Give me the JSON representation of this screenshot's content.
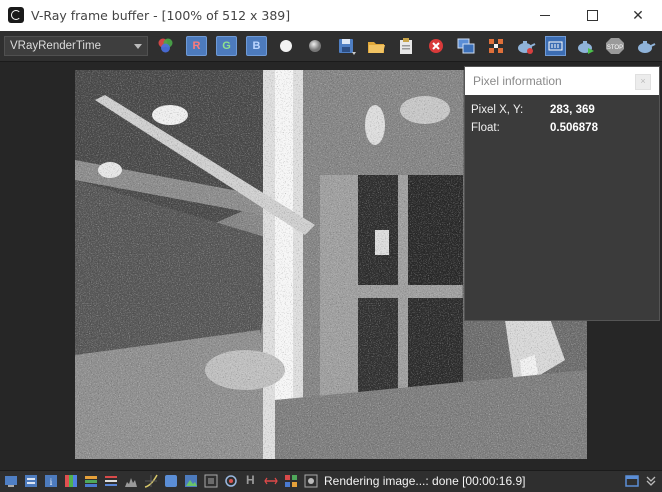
{
  "window": {
    "title": "V-Ray frame buffer - [100% of 512 x 389]",
    "controls": {
      "minimize_icon": "minimize-icon",
      "maximize_icon": "maximize-icon",
      "close_glyph": "✕"
    }
  },
  "toolbar": {
    "channel": "VRayRenderTime",
    "channel_icon": "rgb-circles-icon",
    "r_label": "R",
    "g_label": "G",
    "b_label": "B",
    "icons": [
      "white-dot-icon",
      "gray-dot-icon",
      "save-icon",
      "open-folder-icon",
      "clipboard-icon",
      "clear-icon",
      "duplicate-icon",
      "region-icon",
      "render-teapot-icon",
      "history-icon",
      "interactive-teapot-icon",
      "stop-icon",
      "render-last-icon"
    ]
  },
  "pixel_info": {
    "title": "Pixel information",
    "rows": [
      {
        "label": "Pixel X, Y:",
        "value": "283, 369"
      },
      {
        "label": "Float:",
        "value": "0.506878"
      }
    ]
  },
  "statusbar": {
    "status": "Rendering image...: done [00:00:16.9]",
    "h_label": "H",
    "icons": [
      "display-icon",
      "layers-icon",
      "info-icon",
      "color-correct-icon",
      "hsl-icon",
      "levels-icon",
      "histogram-icon",
      "curve-icon",
      "lut-icon",
      "image-icon",
      "frame-icon",
      "lens-icon",
      "h-icon",
      "compare-icon",
      "tiles-icon",
      "gear-icon",
      "fullscreen-icon",
      "expand-icon"
    ]
  },
  "colors": {
    "accent_blue": "#4d7bbd",
    "background": "#262626",
    "toolbar": "#2f2f2f"
  }
}
